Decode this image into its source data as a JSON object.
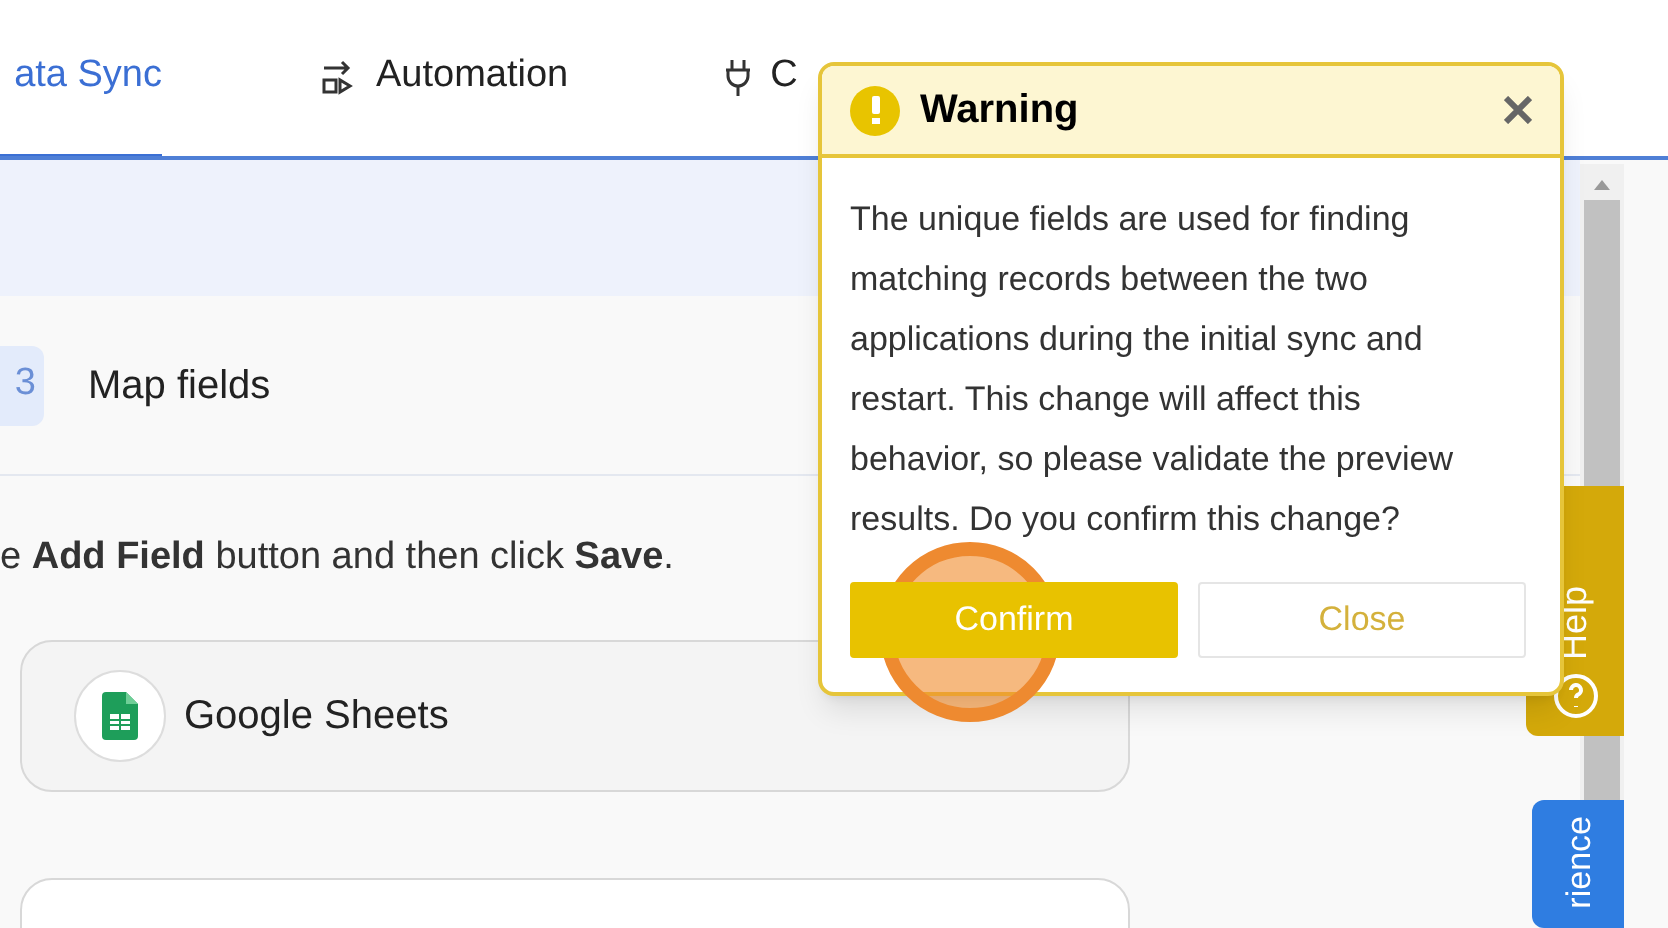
{
  "tabs": [
    {
      "label": "ata Sync",
      "selected": true
    },
    {
      "label": "Automation",
      "selected": false
    },
    {
      "label": "C",
      "selected": false
    }
  ],
  "step": {
    "number": "3",
    "title": "Map fields"
  },
  "instruction": "e **Add Field** button and then click **Save**.",
  "app_card": {
    "name": "Google Sheets"
  },
  "help_tab": {
    "label": "Help"
  },
  "side_tab": {
    "label": "rience"
  },
  "dialog": {
    "title": "Warning",
    "message": "The unique fields are used for finding matching records between the two applications during the initial sync and restart. This change will affect this behavior, so please validate the preview results. Do you confirm this change?",
    "buttons": [
      {
        "label": "Confirm",
        "kind": "primary"
      },
      {
        "label": "Close",
        "kind": "secondary"
      }
    ]
  }
}
